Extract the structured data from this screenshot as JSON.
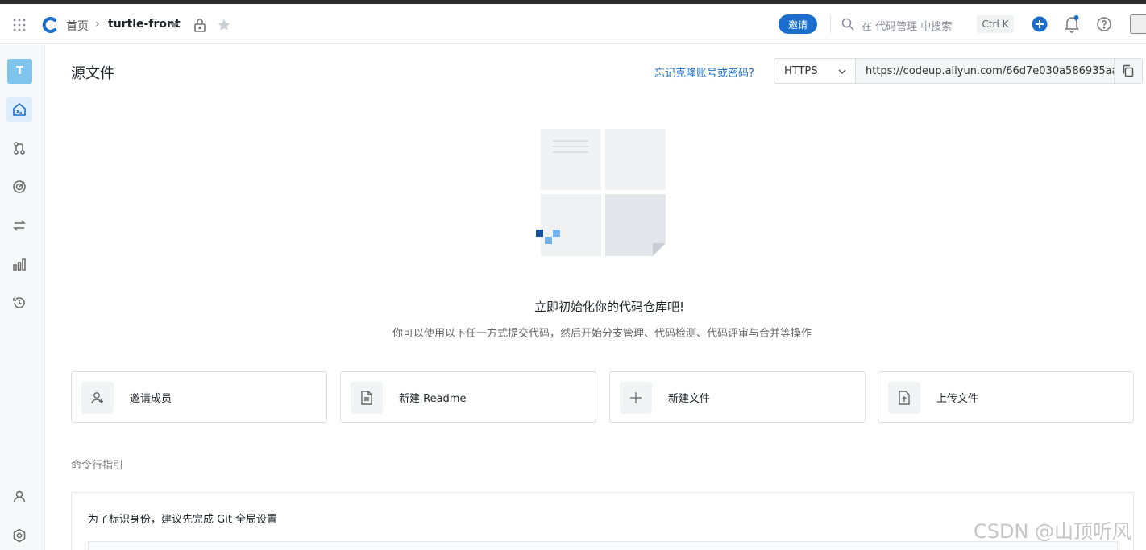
{
  "header": {
    "home": "首页",
    "separator": "›",
    "repo_name": "turtle-front",
    "invite_label": "邀请",
    "search_placeholder": "在 代码管理 中搜索",
    "shortcut": "Ctrl K"
  },
  "sidebar": {
    "avatar_letter": "T",
    "items": [
      {
        "name": "code",
        "icon": "code-home-icon",
        "active": true
      },
      {
        "name": "merge-requests",
        "icon": "branch-icon",
        "active": false
      },
      {
        "name": "detection",
        "icon": "target-icon",
        "active": false
      },
      {
        "name": "sync",
        "icon": "swap-icon",
        "active": false
      },
      {
        "name": "stats",
        "icon": "bar-chart-icon",
        "active": false
      },
      {
        "name": "history",
        "icon": "history-icon",
        "active": false
      }
    ],
    "bottom": [
      {
        "name": "members",
        "icon": "user-icon"
      },
      {
        "name": "settings",
        "icon": "settings-icon"
      }
    ]
  },
  "main": {
    "title": "源文件",
    "forgot_link": "忘记克隆账号或密码?",
    "protocol": "HTTPS",
    "clone_url": "https://codeup.aliyun.com/66d7e030a586935aa",
    "empty_title": "立即初始化你的代码仓库吧!",
    "empty_subtitle": "你可以使用以下任一方式提交代码，然后开始分支管理、代码检测、代码评审与合并等操作",
    "actions": [
      {
        "label": "邀请成员",
        "icon": "add-user-icon"
      },
      {
        "label": "新建 Readme",
        "icon": "document-icon"
      },
      {
        "label": "新建文件",
        "icon": "plus-icon"
      },
      {
        "label": "上传文件",
        "icon": "upload-file-icon"
      }
    ],
    "cli_label": "命令行指引",
    "cli_hint": "为了标识身份，建议先完成 Git 全局设置"
  },
  "watermark": "CSDN @山顶听风",
  "colors": {
    "accent": "#1b6ecb",
    "sidebar_active": "#dfeefb",
    "avatar": "#7fc4ec"
  }
}
